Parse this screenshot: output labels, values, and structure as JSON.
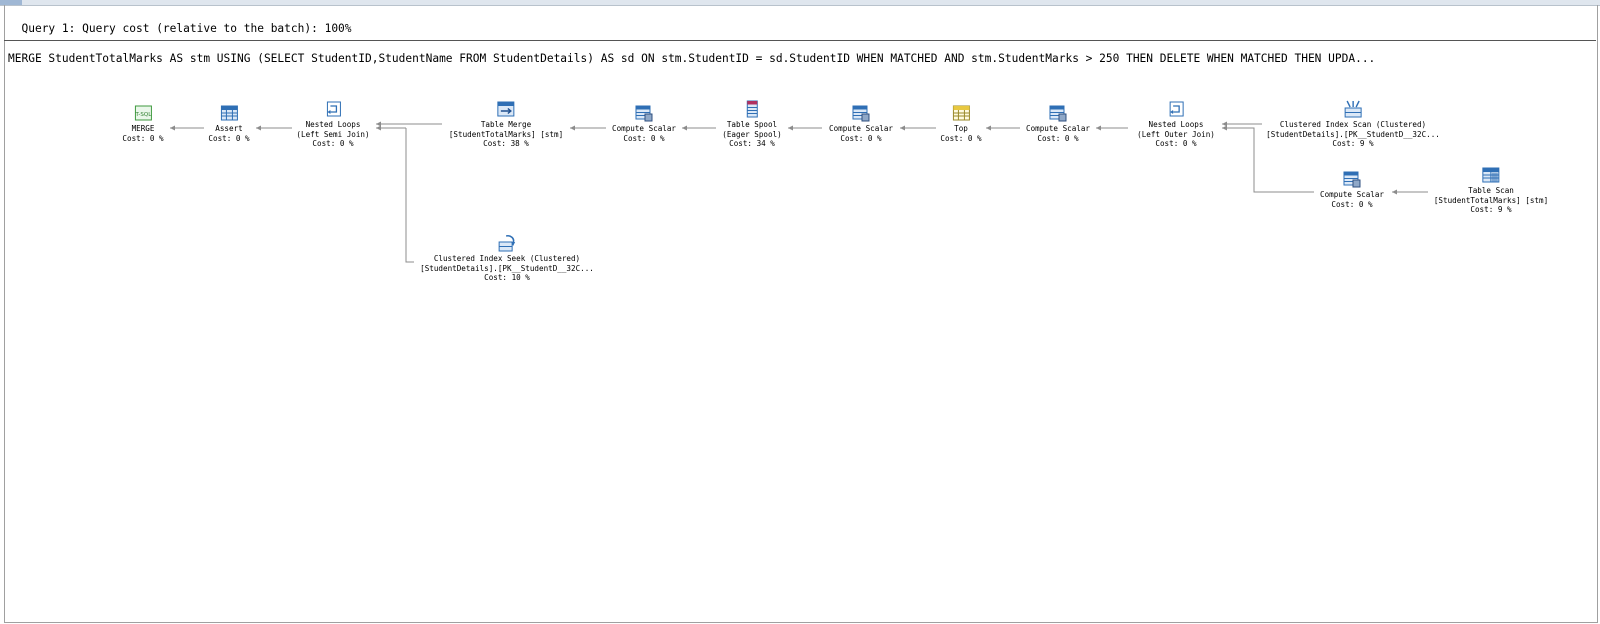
{
  "query": {
    "header": "Query 1: Query cost (relative to the batch): 100%",
    "statement": "MERGE StudentTotalMarks AS stm USING (SELECT StudentID,StudentName FROM StudentDetails) AS sd ON stm.StudentID = sd.StudentID WHEN MATCHED AND stm.StudentMarks > 250 THEN DELETE WHEN MATCHED THEN UPDA..."
  },
  "operators": {
    "merge": {
      "name": "MERGE",
      "cost": "Cost: 0 %",
      "icon": "tsql-icon"
    },
    "assert": {
      "name": "Assert",
      "cost": "Cost: 0 %",
      "icon": "assert-icon"
    },
    "nested_loops_semi": {
      "name": "Nested Loops",
      "detail": "(Left Semi Join)",
      "cost": "Cost: 0 %",
      "icon": "nested-loops-icon"
    },
    "table_merge": {
      "name": "Table Merge",
      "detail": "[StudentTotalMarks] [stm]",
      "cost": "Cost: 38 %",
      "icon": "table-merge-icon"
    },
    "compute_scalar_1": {
      "name": "Compute Scalar",
      "cost": "Cost: 0 %",
      "icon": "compute-scalar-icon"
    },
    "table_spool": {
      "name": "Table Spool",
      "detail": "(Eager Spool)",
      "cost": "Cost: 34 %",
      "icon": "table-spool-icon"
    },
    "compute_scalar_2": {
      "name": "Compute Scalar",
      "cost": "Cost: 0 %",
      "icon": "compute-scalar-icon"
    },
    "top": {
      "name": "Top",
      "cost": "Cost: 0 %",
      "icon": "top-icon"
    },
    "compute_scalar_3": {
      "name": "Compute Scalar",
      "cost": "Cost: 0 %",
      "icon": "compute-scalar-icon"
    },
    "nested_loops_outer": {
      "name": "Nested Loops",
      "detail": "(Left Outer Join)",
      "cost": "Cost: 0 %",
      "icon": "nested-loops-icon"
    },
    "clustered_index_scan": {
      "name": "Clustered Index Scan (Clustered)",
      "detail": "[StudentDetails].[PK__StudentD__32C...",
      "cost": "Cost: 9 %",
      "icon": "clustered-index-scan-icon"
    },
    "compute_scalar_4": {
      "name": "Compute Scalar",
      "cost": "Cost: 0 %",
      "icon": "compute-scalar-icon"
    },
    "table_scan": {
      "name": "Table Scan",
      "detail": "[StudentTotalMarks] [stm]",
      "cost": "Cost: 9 %",
      "icon": "table-scan-icon"
    },
    "clustered_index_seek": {
      "name": "Clustered Index Seek (Clustered)",
      "detail": "[StudentDetails].[PK__StudentD__32C...",
      "cost": "Cost: 10 %",
      "icon": "clustered-index-seek-icon"
    }
  },
  "colors": {
    "arrow": "#8c8c8c",
    "icon_blue": "#2f6fb5",
    "icon_light": "#dbe8f7"
  }
}
